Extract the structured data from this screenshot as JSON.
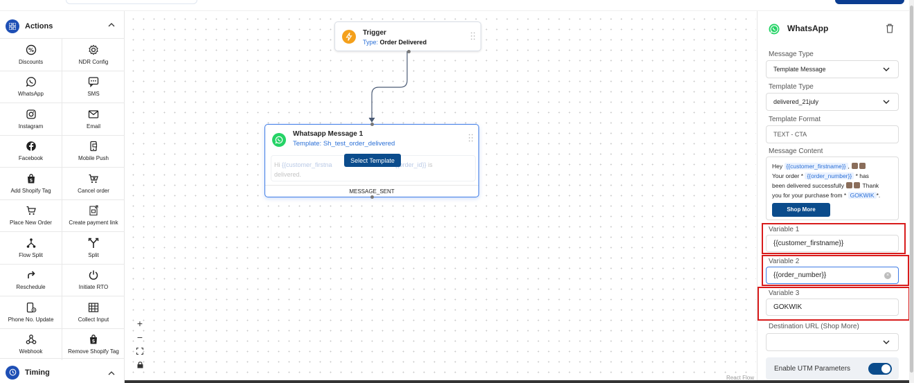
{
  "actions_section": {
    "title": "Actions"
  },
  "actions": [
    {
      "label": "Discounts",
      "icon": "percent-icon"
    },
    {
      "label": "NDR Config",
      "icon": "gear-icon"
    },
    {
      "label": "WhatsApp",
      "icon": "whatsapp-icon"
    },
    {
      "label": "SMS",
      "icon": "sms-icon"
    },
    {
      "label": "Instagram",
      "icon": "instagram-icon"
    },
    {
      "label": "Email",
      "icon": "email-icon"
    },
    {
      "label": "Facebook",
      "icon": "facebook-icon"
    },
    {
      "label": "Mobile Push",
      "icon": "mobile-push-icon"
    },
    {
      "label": "Add Shopify Tag",
      "icon": "shopify-bag-icon"
    },
    {
      "label": "Cancel order",
      "icon": "cart-cancel-icon"
    },
    {
      "label": "Place New Order",
      "icon": "cart-icon"
    },
    {
      "label": "Create payment link",
      "icon": "payment-link-icon"
    },
    {
      "label": "Flow Split",
      "icon": "flow-split-icon"
    },
    {
      "label": "Split",
      "icon": "split-icon"
    },
    {
      "label": "Reschedule",
      "icon": "reschedule-icon"
    },
    {
      "label": "Initiate RTO",
      "icon": "power-icon"
    },
    {
      "label": "Phone No. Update",
      "icon": "phone-update-icon"
    },
    {
      "label": "Collect Input",
      "icon": "collect-input-icon"
    },
    {
      "label": "Webhook",
      "icon": "webhook-icon"
    },
    {
      "label": "Remove Shopify Tag",
      "icon": "shopify-bag-remove-icon"
    }
  ],
  "timing_section": {
    "title": "Timing"
  },
  "trigger_node": {
    "title": "Trigger",
    "type_prefix": "Type:",
    "type_value": "Order Delivered"
  },
  "whatsapp_node": {
    "title": "Whatsapp Message 1",
    "template": "Template: Sh_test_order_delivered",
    "body_hi": "Hi",
    "body_var1": "{{customer_firstna",
    "body_var2": "{{order_id}}",
    "body_is": "is",
    "body_line2": "delivered.",
    "select_button": "Select Template",
    "footer": "MESSAGE_SENT"
  },
  "canvas": {
    "attribution": "React Flow"
  },
  "panel": {
    "title": "WhatsApp",
    "message_type_label": "Message Type",
    "message_type_value": "Template Message",
    "template_type_label": "Template Type",
    "template_type_value": "delivered_21july",
    "template_format_label": "Template Format",
    "template_format_value": "TEXT - CTA",
    "message_content_label": "Message Content",
    "msg": {
      "hey": "Hey",
      "var_firstname": "{{customer_firstname}}",
      "your_order": "Your order *",
      "var_order": "{{order_number}}",
      "has": "* has",
      "delivered": "been delivered successfully",
      "thank": "Thank",
      "purchase": "you for your purchase from *",
      "var_gokwik": "GOKWIK",
      "end": "*."
    },
    "shop_more_button": "Shop More",
    "variable1_label": "Variable 1",
    "variable1_value": "{{customer_firstname}}",
    "variable2_label": "Variable 2",
    "variable2_value": "{{order_number}}",
    "variable3_label": "Variable 3",
    "variable3_value": "GOKWIK",
    "destination_label": "Destination URL (Shop More)",
    "destination_value": "",
    "utm_label": "Enable UTM Parameters",
    "utm_enabled": true
  },
  "colors": {
    "accent": "#0b4c8c",
    "highlight": "#d81b1b",
    "whatsapp": "#25d366",
    "trigger": "#f4a01b"
  }
}
